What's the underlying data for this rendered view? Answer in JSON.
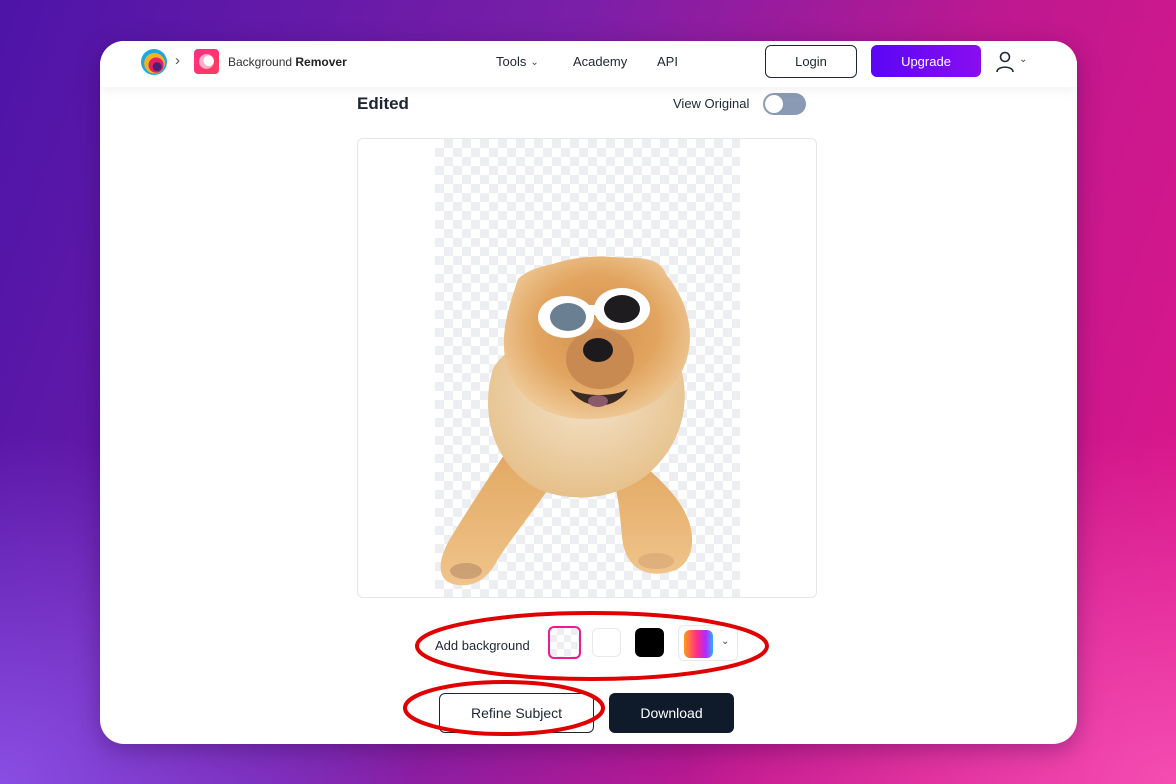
{
  "header": {
    "breadcrumb_separator": "›",
    "app_name_regular": "Background",
    "app_name_bold": "Remover",
    "nav": [
      {
        "label": "Tools",
        "has_dropdown": true
      },
      {
        "label": "Academy"
      },
      {
        "label": "API"
      }
    ],
    "login_label": "Login",
    "upgrade_label": "Upgrade",
    "icons": {
      "logo": "brand-logo-icon",
      "app": "background-remover-app-icon",
      "user": "user-icon",
      "chevron": "chevron-down-icon"
    }
  },
  "editor": {
    "title": "Edited",
    "view_original_label": "View Original",
    "view_original_on": false,
    "image_alt": "Chow chow dog wearing white sunglasses with background removed"
  },
  "background_picker": {
    "label": "Add background",
    "options": [
      {
        "name": "transparent",
        "selected": true
      },
      {
        "name": "white",
        "color": "#ffffff"
      },
      {
        "name": "black",
        "color": "#000000"
      },
      {
        "name": "gradient",
        "colors": [
          "#ff9a1a",
          "#ff2b8a",
          "#b02bff",
          "#2fb0ff"
        ]
      }
    ]
  },
  "actions": {
    "refine_label": "Refine Subject",
    "download_label": "Download"
  },
  "colors": {
    "accent_pink": "#f01a8c",
    "upgrade_start": "#5a06f5",
    "upgrade_end": "#8a0df0",
    "dark": "#0f1a2b",
    "annotation_red": "#e00000"
  }
}
